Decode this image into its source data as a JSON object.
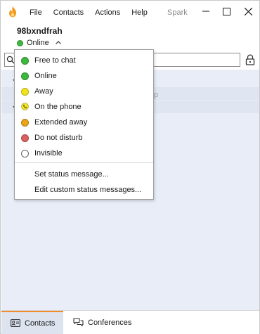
{
  "window": {
    "app_name": "Spark",
    "menu": [
      "File",
      "Contacts",
      "Actions",
      "Help"
    ]
  },
  "profile": {
    "username": "98bxndfrah",
    "status": "Online",
    "status_color": "#3cb93c"
  },
  "search": {
    "value": "",
    "placeholder": ""
  },
  "contact_list": {
    "peek_text": "p"
  },
  "status_menu": {
    "items": [
      {
        "label": "Free to chat",
        "icon": "free-to-chat-dot",
        "color": "#3cb93c"
      },
      {
        "label": "Online",
        "icon": "online-dot",
        "color": "#3cb93c"
      },
      {
        "label": "Away",
        "icon": "away-dot",
        "color": "#f2e41a"
      },
      {
        "label": "On the phone",
        "icon": "phone-icon",
        "color": "#f2e41a"
      },
      {
        "label": "Extended away",
        "icon": "extended-away-dot",
        "color": "#e8a416"
      },
      {
        "label": "Do not disturb",
        "icon": "do-not-disturb-dot",
        "color": "#d9605f"
      },
      {
        "label": "Invisible",
        "icon": "invisible-dot",
        "color": "#ffffff"
      }
    ],
    "actions": [
      "Set status message...",
      "Edit custom status messages..."
    ]
  },
  "tabs": [
    {
      "label": "Contacts",
      "icon": "contacts-card-icon",
      "active": true
    },
    {
      "label": "Conferences",
      "icon": "chat-bubbles-icon",
      "active": false
    }
  ],
  "colors": {
    "accent": "#f28c28",
    "list_bg": "#e8edf7",
    "active_tab": "#dde4ef"
  }
}
